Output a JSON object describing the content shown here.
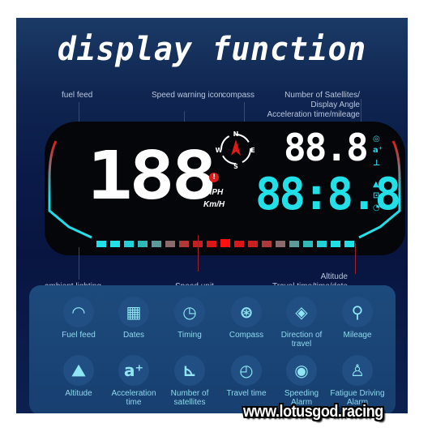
{
  "header": {
    "title": "display function"
  },
  "callouts": {
    "fuel_feed": "fuel feed",
    "speed_warning": "Speed warning icon",
    "compass": "compass",
    "satellites_line1": "Number of Satellites/",
    "satellites_line2": "Display Angle",
    "satellites_line3": "Acceleration time/mileage",
    "ambient": "ambient lighting",
    "speed_unit": "Speed unit",
    "altitude_line1": "Altitude",
    "altitude_line2": "Travel time/time/date"
  },
  "hud": {
    "speed_digits": "188",
    "top_digits": "88.8",
    "bottom_digits": "88:8.8",
    "unit_mph": "MPH",
    "unit_kmh": "Km/H",
    "warning_glyph": "!",
    "compass": {
      "n": "N",
      "s": "S",
      "e": "E",
      "w": "W"
    },
    "colors": {
      "primary": "#ffffff",
      "cyan": "#22e0e8",
      "red": "#e01818"
    }
  },
  "features": [
    {
      "icon": "fuel-gauge-icon",
      "label": "Fuel feed"
    },
    {
      "icon": "calendar-icon",
      "label": "Dates"
    },
    {
      "icon": "clock-icon",
      "label": "Timing"
    },
    {
      "icon": "compass-icon",
      "label": "Compass"
    },
    {
      "icon": "direction-icon",
      "label": "Direction of travel"
    },
    {
      "icon": "map-pin-icon",
      "label": "Mileage"
    },
    {
      "icon": "mountain-icon",
      "label": "Altitude"
    },
    {
      "icon": "acceleration-icon",
      "label": "Acceleration time"
    },
    {
      "icon": "satellite-icon",
      "label": "Number of satellites"
    },
    {
      "icon": "travel-time-icon",
      "label": "Travel time"
    },
    {
      "icon": "speeding-alarm-icon",
      "label": "Speeding Alarm"
    },
    {
      "icon": "fatigue-icon",
      "label": "Fatigue Driving Alarm"
    }
  ],
  "watermark": "www.lotusgod.racing"
}
